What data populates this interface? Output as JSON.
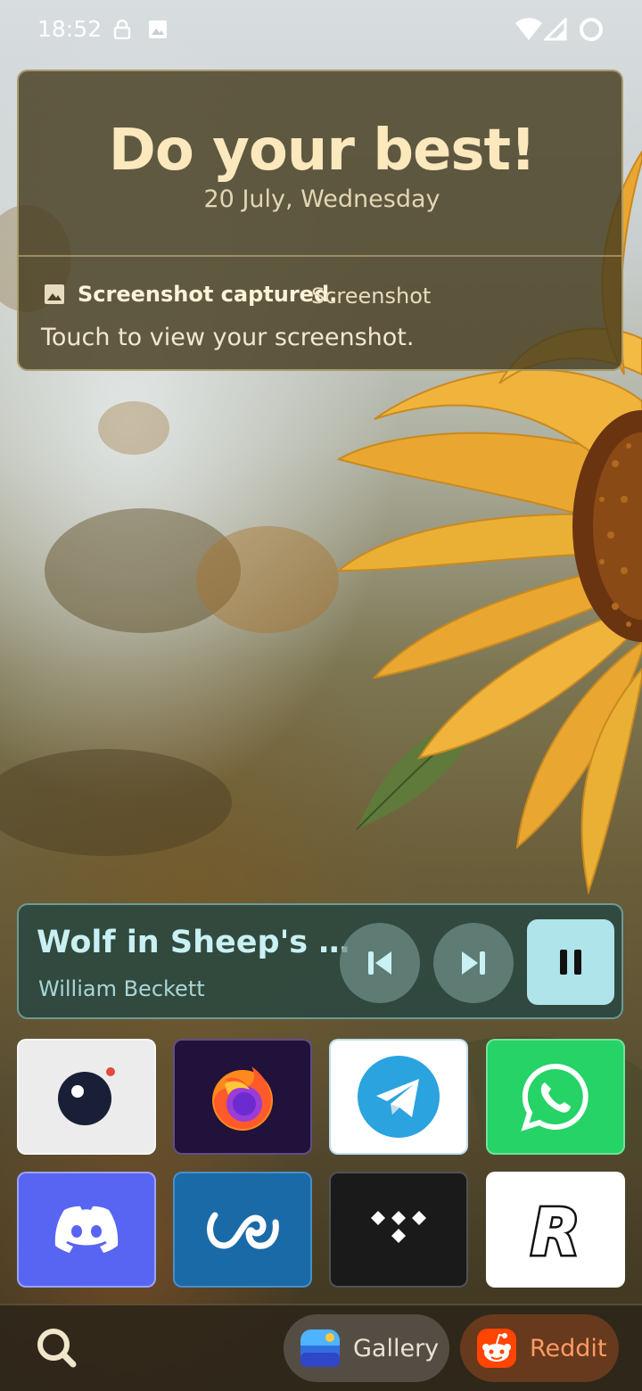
{
  "status_bar": {
    "time": "18:52",
    "icons": [
      "lock-icon",
      "image-icon",
      "wifi-icon",
      "cellular-signal-icon",
      "battery-ring-icon"
    ]
  },
  "top_widget": {
    "motto": "Do your best!",
    "date": "20 July, Wednesday"
  },
  "notification": {
    "icon": "image-icon",
    "title": "Screenshot captured.",
    "app": "Screenshot",
    "body": "Touch to view your screenshot."
  },
  "media_player": {
    "track": "Wolf in Sheep's …",
    "artist": "William Beckett",
    "controls": [
      "previous-track",
      "next-track",
      "pause"
    ],
    "accent": "#aee4ea"
  },
  "apps": [
    {
      "name": "camera",
      "icon": "camera-app-icon",
      "bg": "#ececec"
    },
    {
      "name": "firefox",
      "icon": "firefox-app-icon",
      "bg": "#20123a"
    },
    {
      "name": "telegram",
      "icon": "telegram-app-icon",
      "bg": "#ffffff"
    },
    {
      "name": "whatsapp",
      "icon": "whatsapp-app-icon",
      "bg": "#25d366"
    },
    {
      "name": "discord",
      "icon": "discord-app-icon",
      "bg": "#5865f2"
    },
    {
      "name": "wallet-app",
      "icon": "infinity-app-icon",
      "bg": "#1a6aa8"
    },
    {
      "name": "tidal",
      "icon": "tidal-app-icon",
      "bg": "#1a1a1a"
    },
    {
      "name": "revolut",
      "icon": "revolut-app-icon",
      "bg": "#ffffff"
    }
  ],
  "dock": {
    "search_icon": "search-icon",
    "shortcuts": [
      {
        "label": "Gallery",
        "icon": "gallery-app-icon"
      },
      {
        "label": "Reddit",
        "icon": "reddit-app-icon"
      }
    ]
  }
}
